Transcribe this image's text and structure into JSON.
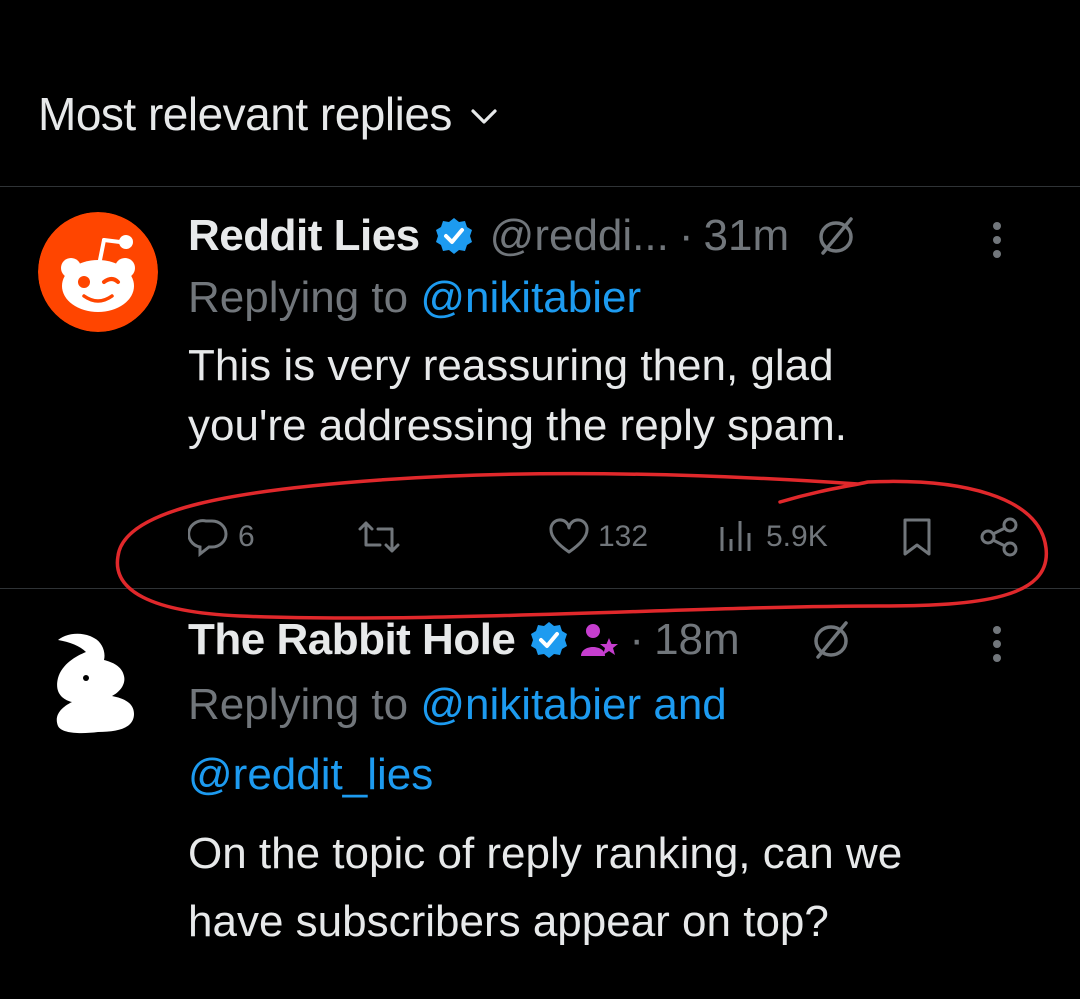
{
  "header": {
    "title": "Most relevant replies",
    "chevron_icon": "chevron-down-icon"
  },
  "tweets": [
    {
      "name": "Reddit Lies",
      "verified_icon": "verified-badge-icon",
      "handle": "@reddi...",
      "separator": "·",
      "time": "31m",
      "grok_icon": "grok-icon",
      "more_icon": "more-vertical-icon",
      "replying_prefix": "Replying to",
      "replying_to": "@nikitabier",
      "text_line1": "This is very reassuring then, glad",
      "text_line2": "you're addressing the reply spam.",
      "actions": {
        "replies": "6",
        "retweets": "",
        "likes": "132",
        "views": "5.9K"
      }
    },
    {
      "name": "The Rabbit Hole",
      "verified_icon": "verified-badge-icon",
      "affiliate_icon": "person-star-icon",
      "separator": "·",
      "time": "18m",
      "grok_icon": "grok-icon",
      "more_icon": "more-vertical-icon",
      "replying_prefix": "Replying to",
      "replying_to_1": "@nikitabier and",
      "replying_to_2": "@reddit_lies",
      "text_line1": "On the topic of reply ranking, can we",
      "text_line2": "have subscribers appear on top?"
    }
  ],
  "colors": {
    "background": "#000000",
    "text": "#e7e9ea",
    "muted": "#71767b",
    "accent": "#1d9bf0",
    "reddit_orange": "#ff4500",
    "annotation_red": "#e0282b",
    "affiliate_purple": "#c63ecf"
  }
}
